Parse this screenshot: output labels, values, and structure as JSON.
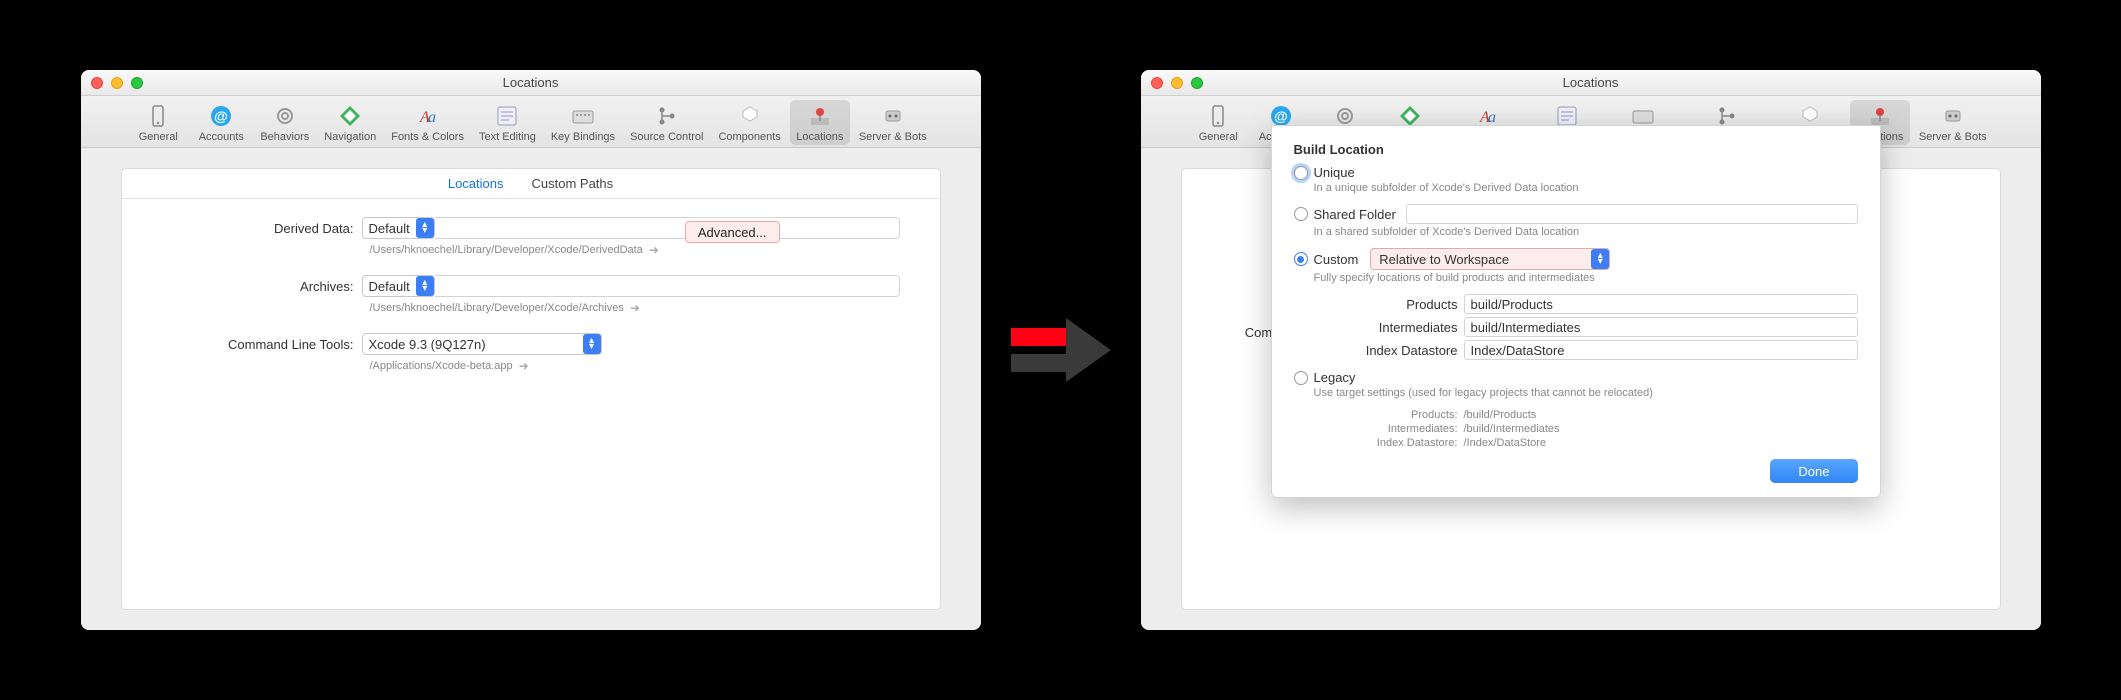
{
  "window": {
    "title": "Locations",
    "toolbar": [
      {
        "id": "general",
        "label": "General"
      },
      {
        "id": "accounts",
        "label": "Accounts"
      },
      {
        "id": "behaviors",
        "label": "Behaviors"
      },
      {
        "id": "navigation",
        "label": "Navigation"
      },
      {
        "id": "fonts",
        "label": "Fonts & Colors"
      },
      {
        "id": "textediting",
        "label": "Text Editing"
      },
      {
        "id": "keybindings",
        "label": "Key Bindings"
      },
      {
        "id": "sourcecontrol",
        "label": "Source Control"
      },
      {
        "id": "components",
        "label": "Components"
      },
      {
        "id": "locations",
        "label": "Locations",
        "selected": true
      },
      {
        "id": "serverbots",
        "label": "Server & Bots"
      }
    ]
  },
  "left": {
    "tabs": {
      "locations": "Locations",
      "custom": "Custom Paths"
    },
    "derived": {
      "label": "Derived Data:",
      "value": "Default",
      "path": "/Users/hknoechel/Library/Developer/Xcode/DerivedData",
      "advanced": "Advanced..."
    },
    "archives": {
      "label": "Archives:",
      "value": "Default",
      "path": "/Users/hknoechel/Library/Developer/Xcode/Archives"
    },
    "cli": {
      "label": "Command Line Tools:",
      "value": "Xcode 9.3 (9Q127n)",
      "path": "/Applications/Xcode-beta.app"
    }
  },
  "right": {
    "cutoff_label": "Comman",
    "sheet": {
      "title": "Build Location",
      "unique": {
        "label": "Unique",
        "desc": "In a unique subfolder of Xcode's Derived Data location"
      },
      "shared": {
        "label": "Shared Folder",
        "desc": "In a shared subfolder of Xcode's Derived Data location"
      },
      "custom": {
        "label": "Custom",
        "mode": "Relative to Workspace",
        "desc": "Fully specify locations of build products and intermediates",
        "products": {
          "label": "Products",
          "value": "build/Products"
        },
        "intermediates": {
          "label": "Intermediates",
          "value": "build/Intermediates"
        },
        "index": {
          "label": "Index Datastore",
          "value": "Index/DataStore"
        }
      },
      "legacy": {
        "label": "Legacy",
        "desc": "Use target settings (used for legacy projects that cannot be relocated)"
      },
      "summary": {
        "products": {
          "label": "Products:",
          "value": "/build/Products"
        },
        "intermediates": {
          "label": "Intermediates:",
          "value": "/build/Intermediates"
        },
        "index": {
          "label": "Index Datastore:",
          "value": "/Index/DataStore"
        }
      },
      "done": "Done"
    }
  }
}
